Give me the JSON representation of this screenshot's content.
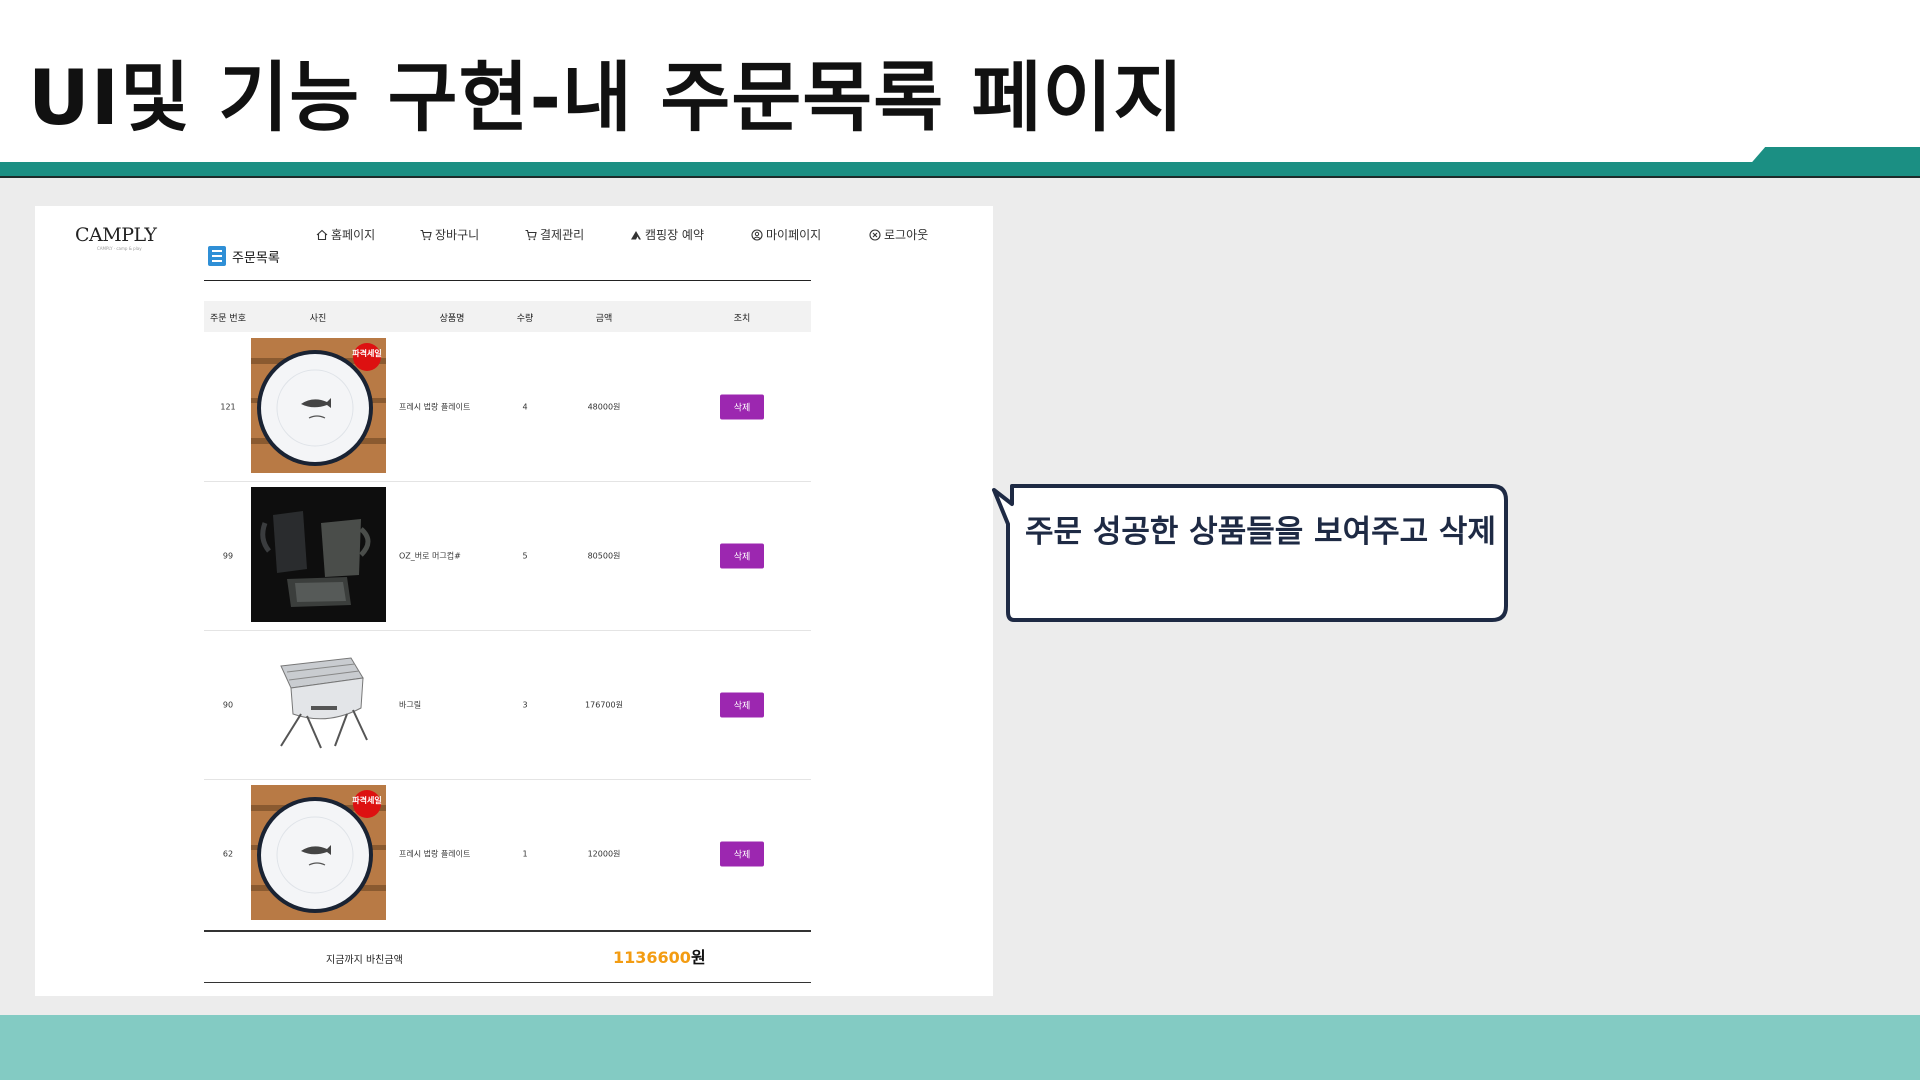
{
  "slide": {
    "title": "UI및 기능 구현-내 주문목록 페이지",
    "callout_text": "주문 성공한 상품들을 보여주고 삭제"
  },
  "app": {
    "logo": "CAMPLY",
    "logo_tagline": "CAMPLY · camp & play",
    "nav": [
      {
        "label": "홈페이지",
        "icon": "home-icon"
      },
      {
        "label": "장바구니",
        "icon": "cart-icon"
      },
      {
        "label": "결제관리",
        "icon": "cart-icon"
      },
      {
        "label": "캠핑장 예약",
        "icon": "tent-icon"
      },
      {
        "label": "마이페이지",
        "icon": "user-circle-icon"
      },
      {
        "label": "로그아웃",
        "icon": "close-circle-icon"
      }
    ],
    "page_heading": "주문목록",
    "table": {
      "headers": [
        "주문 번호",
        "사진",
        "상품명",
        "수량",
        "금액",
        "조치"
      ],
      "rows": [
        {
          "order_no": "121",
          "photo": "plate-image",
          "badge": "파격세일",
          "name": "프레시 법랑 플레이트",
          "qty": "4",
          "price": "48000원",
          "action": "삭제"
        },
        {
          "order_no": "99",
          "photo": "mug-set-image",
          "badge": "",
          "name": "OZ_버로 머그컵#",
          "qty": "5",
          "price": "80500원",
          "action": "삭제"
        },
        {
          "order_no": "90",
          "photo": "grill-image",
          "badge": "",
          "name": "바그릴",
          "qty": "3",
          "price": "176700원",
          "action": "삭제"
        },
        {
          "order_no": "62",
          "photo": "plate-image",
          "badge": "파격세일",
          "name": "프레시 법랑 플레이트",
          "qty": "1",
          "price": "12000원",
          "action": "삭제"
        }
      ]
    },
    "total": {
      "label": "지금까지 바친금액",
      "amount": "1136600",
      "unit": "원"
    }
  },
  "colors": {
    "teal": "#1b8f83",
    "light_teal": "#83cbc3",
    "delete_button": "#9c27b0",
    "total_amount": "#f39c12",
    "callout_border": "#1e2a44"
  }
}
